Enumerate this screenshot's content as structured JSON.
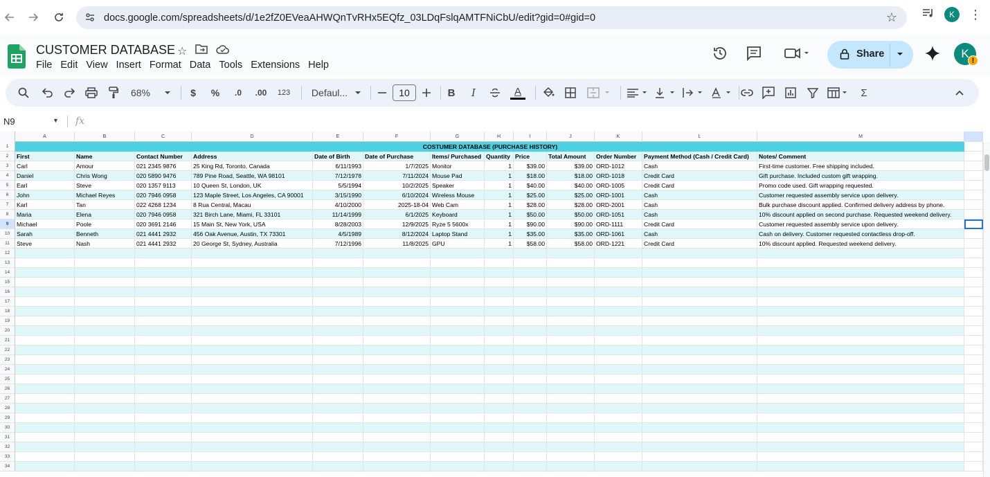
{
  "browser": {
    "url": "docs.google.com/spreadsheets/d/1e2fZ0EVeaAHWQnTvRHx5EQfz_03LDqFslqAMTFNiCbU/edit?gid=0#gid=0",
    "profile_initial": "K"
  },
  "app": {
    "title": "CUSTOMER DATABASE",
    "menu": [
      "File",
      "Edit",
      "View",
      "Insert",
      "Format",
      "Data",
      "Tools",
      "Extensions",
      "Help"
    ],
    "share_label": "Share",
    "avatar_initial": "K",
    "warning_badge": "!"
  },
  "toolbar": {
    "zoom": "68%",
    "currency": "$",
    "percent": "%",
    "dec_decrease": ".0",
    "dec_increase": ".00",
    "number_format": "123",
    "font": "Defaul...",
    "font_size": "10",
    "bold": "B",
    "italic": "I",
    "text_color": "A",
    "sigma": "Σ"
  },
  "formula_bar": {
    "cell_ref": "N9",
    "fx_label": "fx"
  },
  "sheet": {
    "columns": [
      "A",
      "B",
      "C",
      "D",
      "E",
      "F",
      "G",
      "H",
      "I",
      "J",
      "K",
      "L",
      "M"
    ],
    "title_row": "COSTUMER DATABASE (PURCHASE HISTORY)",
    "headers": [
      "First",
      "Name",
      "Contact Number",
      "Address",
      "Date of Birth",
      "Date of Purchase",
      "Items/ Purchased",
      "Quantity",
      "Price",
      "Total Amount",
      "Order Number",
      "Payment Method (Cash / Credit Card)",
      "Notes/ Comment"
    ],
    "rows": [
      [
        "Carl",
        "Amour",
        "021 2345 9876",
        "25 King Rd, Toronto, Canada",
        "6/11/1993",
        "1/7/2025",
        "Monitor",
        "1",
        "$39.00",
        "$39.00",
        "ORD-1012",
        "Cash",
        "First-time customer. Free shipping included."
      ],
      [
        "Daniel",
        "Chris Wong",
        "020 5890 9476",
        "789 Pine Road, Seattle, WA 98101",
        "7/12/1978",
        "7/11/2024",
        "Mouse Pad",
        "1",
        "$18.00",
        "$18.00",
        "ORD-1018",
        "Credit Card",
        "Gift purchase. Included custom gift wrapping."
      ],
      [
        "Earl",
        "Steve",
        "020 1357 9113",
        "10 Queen St, London, UK",
        "5/5/1994",
        "10/2/2025",
        "Speaker",
        "1",
        "$40.00",
        "$40.00",
        "ORD-1005",
        "Credit Card",
        "Promo code used. Gift wrapping requested."
      ],
      [
        "John",
        "Michael Reyes",
        "020 7946 0958",
        "123 Maple Street, Los Angeles, CA 90001",
        "3/15/1990",
        "6/10/2024",
        "Wireless Mouse",
        "1",
        "$25.00",
        "$25.00",
        "ORD-1001",
        "Cash",
        "Customer requested assembly service upon delivery."
      ],
      [
        "Karl",
        "Tan",
        "022 4268 1234",
        "8 Rua Central, Macau",
        "4/10/2000",
        "2025-18-04",
        "Web Cam",
        "1",
        "$28.00",
        "$28.00",
        "ORD-2001",
        "Cash",
        "Bulk purchase discount applied. Confirmed delivery address by phone."
      ],
      [
        "Maria",
        "Elena",
        "020 7946 0958",
        "321 Birch Lane, Miami, FL 33101",
        "11/14/1999",
        "6/1/2025",
        "Keyboard",
        "1",
        "$50.00",
        "$50.00",
        "ORD-1051",
        "Cash",
        "10% discount applied on second purchase. Requested weekend delivery."
      ],
      [
        "Michael",
        "Poole",
        "020 3691 2146",
        "15 Main St, New York, USA",
        "8/28/2003",
        "12/9/2025",
        "Ryze 5 5600x",
        "1",
        "$90.00",
        "$90.00",
        "ORD-1111",
        "Credit Card",
        "Customer requested assembly service upon delivery."
      ],
      [
        "Sarah",
        "Benneth",
        "021 4441 2932",
        "456 Oak Avenue, Austin, TX 73301",
        "4/5/1989",
        "8/12/2024",
        "Laptop Stand",
        "1",
        "$35.00",
        "$35.00",
        "ORD-1061",
        "Cash",
        "Cash on delivery. Customer requested contactless drop-off."
      ],
      [
        "Steve",
        "Nash",
        "021 4441 2932",
        "20 George St, Sydney, Australia",
        "7/12/1996",
        "11/8/2025",
        "GPU",
        "1",
        "$58.00",
        "$58.00",
        "ORD-1221",
        "Credit Card",
        "10% discount applied. Requested weekend delivery."
      ]
    ],
    "row_numbers": [
      "1",
      "2",
      "3",
      "4",
      "5",
      "6",
      "7",
      "8",
      "9",
      "10",
      "11",
      "12",
      "13",
      "14",
      "15",
      "16",
      "17",
      "18",
      "19",
      "20",
      "21",
      "22",
      "23",
      "24",
      "25",
      "26",
      "27",
      "28",
      "29",
      "30",
      "31",
      "32",
      "33",
      "34"
    ],
    "selected_row": "9"
  },
  "colors": {
    "title_band": "#4dd0e1",
    "alt_band": "#e0f7fa",
    "share_bg": "#c2e7ff"
  }
}
